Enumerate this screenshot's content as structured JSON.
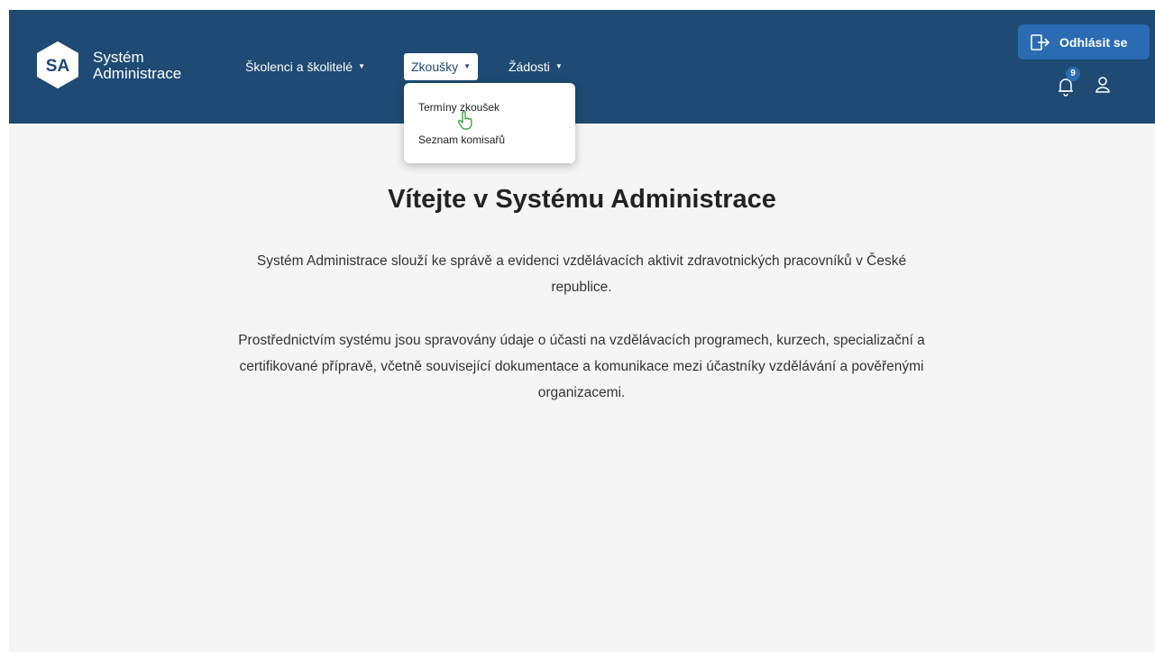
{
  "brand": {
    "logo_text": "SA",
    "line1": "Systém",
    "line2": "Administrace"
  },
  "nav": {
    "items": [
      {
        "label": "Školenci a školitelé"
      },
      {
        "label": "Zkoušky"
      },
      {
        "label": "Žádosti"
      }
    ],
    "dropdown": {
      "items": [
        {
          "label": "Termíny zkoušek"
        },
        {
          "label": "Seznam komisařů"
        }
      ]
    }
  },
  "header_actions": {
    "logout_label": "Odhlásit se",
    "notification_count": "9"
  },
  "main": {
    "title": "Vítejte v Systému Administrace",
    "paragraph1": "Systém Administrace slouží ke správě a evidenci vzdělávacích aktivit zdravotnických pracovníků v České republice.",
    "paragraph2": "Prostřednictvím systému jsou spravovány údaje o účasti na vzdělávacích programech, kurzech, specializační a certifikované přípravě, včetně související dokumentace a komunikace mezi účastníky vzdělávání a pověřenými organizacemi."
  },
  "colors": {
    "header_bg": "#1e4a73",
    "accent": "#2b6bb3",
    "page_bg": "#f5f5f5"
  }
}
